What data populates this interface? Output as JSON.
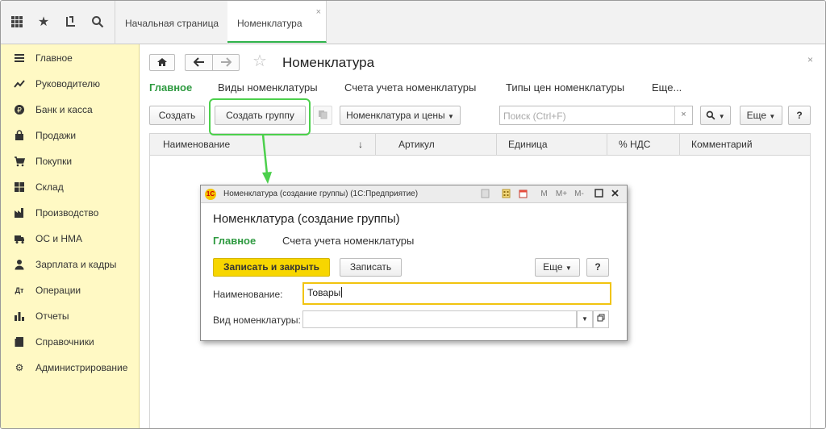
{
  "tabs": [
    {
      "label": "Начальная страница"
    },
    {
      "label": "Номенклатура",
      "close": "×"
    }
  ],
  "sidebar": {
    "items": [
      {
        "label": "Главное"
      },
      {
        "label": "Руководителю"
      },
      {
        "label": "Банк и касса"
      },
      {
        "label": "Продажи"
      },
      {
        "label": "Покупки"
      },
      {
        "label": "Склад"
      },
      {
        "label": "Производство"
      },
      {
        "label": "ОС и НМА"
      },
      {
        "label": "Зарплата и кадры"
      },
      {
        "label": "Операции"
      },
      {
        "label": "Отчеты"
      },
      {
        "label": "Справочники"
      },
      {
        "label": "Администрирование"
      }
    ]
  },
  "main": {
    "title": "Номенклатура",
    "close": "×",
    "tabs": [
      "Главное",
      "Виды номенклатуры",
      "Счета учета номенклатуры",
      "Типы цен номенклатуры",
      "Еще..."
    ],
    "toolbar": {
      "create": "Создать",
      "create_group": "Создать группу",
      "nomenclature_prices": "Номенклатура и цены",
      "search_placeholder": "Поиск (Ctrl+F)",
      "search_clear": "×",
      "more": "Еще",
      "help": "?"
    },
    "table": {
      "columns": [
        "Наименование",
        "Артикул",
        "Единица",
        "% НДС",
        "Комментарий"
      ],
      "sort_indicator": "↓"
    }
  },
  "dialog": {
    "window_title": "Номенклатура (создание группы)  (1С:Предприятие)",
    "logo": "1С",
    "title_controls": [
      "M",
      "M+",
      "M-"
    ],
    "heading": "Номенклатура (создание группы)",
    "tabs": [
      "Главное",
      "Счета учета номенклатуры"
    ],
    "buttons": {
      "save_close": "Записать и закрыть",
      "save": "Записать",
      "more": "Еще",
      "help": "?"
    },
    "fields": {
      "name_label": "Наименование:",
      "name_value": "Товары",
      "kind_label": "Вид номенклатуры:",
      "kind_value": ""
    }
  },
  "colors": {
    "accent_green": "#2e9a40",
    "sidebar_bg": "#fff9c4",
    "primary_button": "#f7d600",
    "highlight": "#4cd04c"
  }
}
